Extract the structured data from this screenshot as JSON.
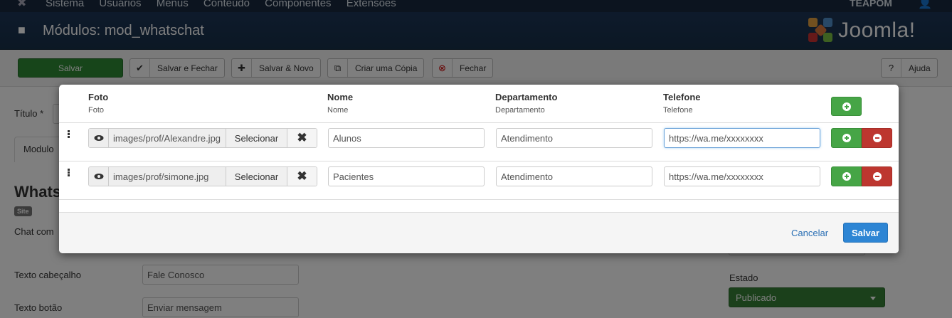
{
  "topmenu": {
    "items": [
      "Sistema",
      "Usuários",
      "Menus",
      "Conteúdo",
      "Componentes",
      "Extensões"
    ],
    "user": "TEAPOM"
  },
  "header": {
    "title": "Módulos: mod_whatschat",
    "brand": "Joomla!"
  },
  "toolbar": {
    "save": "Salvar",
    "save_close": "Salvar e Fechar",
    "save_new": "Salvar & Novo",
    "copy": "Criar uma Cópia",
    "close": "Fechar",
    "help": "Ajuda"
  },
  "background": {
    "title_label": "Título *",
    "tab": "Modulo",
    "heading": "Whats",
    "badge": "Site",
    "description": "Chat com",
    "header_text_label": "Texto cabeçalho",
    "header_text_value": "Fale Conosco",
    "button_text_label": "Texto botão",
    "button_text_value": "Enviar mensagem",
    "status_label": "Estado",
    "status_value": "Publicado"
  },
  "modal": {
    "columns": [
      {
        "title": "Foto",
        "subtitle": "Foto"
      },
      {
        "title": "Nome",
        "subtitle": "Nome"
      },
      {
        "title": "Departamento",
        "subtitle": "Departamento"
      },
      {
        "title": "Telefone",
        "subtitle": "Telefone"
      }
    ],
    "select_label": "Selecionar",
    "rows": [
      {
        "foto": "images/prof/Alexandre.jpg",
        "nome": "Alunos",
        "departamento": "Atendimento",
        "telefone": "https://wa.me/xxxxxxxx"
      },
      {
        "foto": "images/prof/simone.jpg",
        "nome": "Pacientes",
        "departamento": "Atendimento",
        "telefone": "https://wa.me/xxxxxxxx"
      }
    ],
    "cancel": "Cancelar",
    "save": "Salvar"
  },
  "colors": {
    "header_bg": "#1d3557",
    "green": "#46a546",
    "red": "#bd362f",
    "primary": "#2d85d4",
    "link": "#2a6fb4"
  }
}
